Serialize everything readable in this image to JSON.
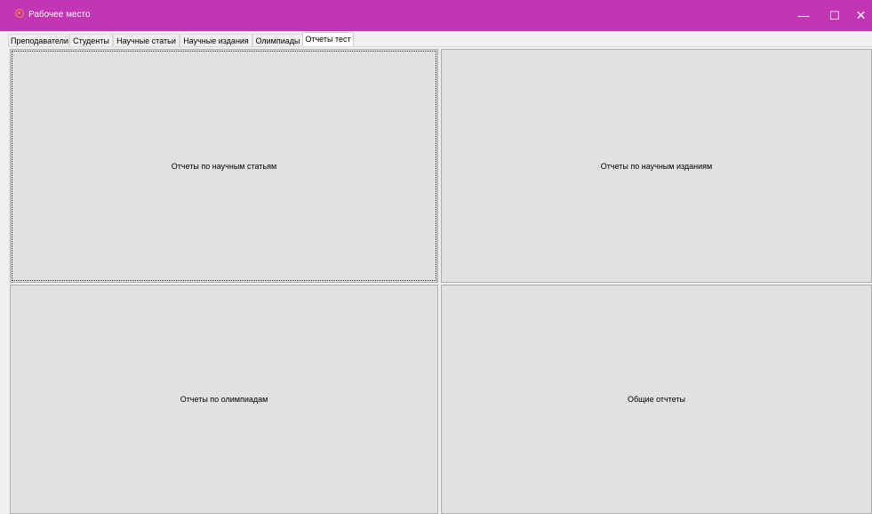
{
  "window": {
    "title": "Рабочее место",
    "icon": "app-gear-icon",
    "controls": {
      "minimize": "—",
      "maximize": "☐",
      "close": "✕"
    },
    "title_bar_color": "#c236b3"
  },
  "tabs": [
    {
      "label": "Преподаватели"
    },
    {
      "label": "Студенты"
    },
    {
      "label": "Научные статьи"
    },
    {
      "label": "Научные издания"
    },
    {
      "label": "Олимпиады"
    },
    {
      "label": "Отчеты тест"
    }
  ],
  "active_tab": "Отчеты тест",
  "reports": {
    "articles": "Отчеты по научным статьям",
    "publications": "Отчеты по научным изданиям",
    "olympiads": "Отчеты по олимпиадам",
    "general": "Общие отчтеты"
  }
}
